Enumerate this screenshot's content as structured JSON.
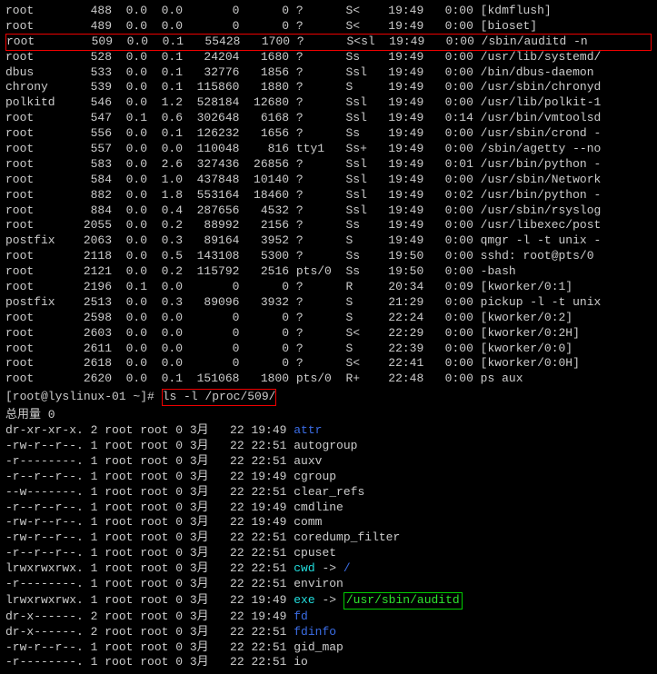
{
  "ps": [
    {
      "user": "root",
      "pid": "488",
      "c1": "0.0",
      "c2": "0.0",
      "vsz": "0",
      "rss": "0",
      "tty": "?",
      "stat": "S<",
      "start": "19:49",
      "time": "0:00",
      "cmd": "[kdmflush]",
      "boxed": false
    },
    {
      "user": "root",
      "pid": "489",
      "c1": "0.0",
      "c2": "0.0",
      "vsz": "0",
      "rss": "0",
      "tty": "?",
      "stat": "S<",
      "start": "19:49",
      "time": "0:00",
      "cmd": "[bioset]",
      "boxed": false
    },
    {
      "user": "root",
      "pid": "509",
      "c1": "0.0",
      "c2": "0.1",
      "vsz": "55428",
      "rss": "1700",
      "tty": "?",
      "stat": "S<sl",
      "start": "19:49",
      "time": "0:00",
      "cmd": "/sbin/auditd -n",
      "boxed": true
    },
    {
      "user": "root",
      "pid": "528",
      "c1": "0.0",
      "c2": "0.1",
      "vsz": "24204",
      "rss": "1680",
      "tty": "?",
      "stat": "Ss",
      "start": "19:49",
      "time": "0:00",
      "cmd": "/usr/lib/systemd/",
      "boxed": false
    },
    {
      "user": "dbus",
      "pid": "533",
      "c1": "0.0",
      "c2": "0.1",
      "vsz": "32776",
      "rss": "1856",
      "tty": "?",
      "stat": "Ssl",
      "start": "19:49",
      "time": "0:00",
      "cmd": "/bin/dbus-daemon",
      "boxed": false
    },
    {
      "user": "chrony",
      "pid": "539",
      "c1": "0.0",
      "c2": "0.1",
      "vsz": "115860",
      "rss": "1880",
      "tty": "?",
      "stat": "S",
      "start": "19:49",
      "time": "0:00",
      "cmd": "/usr/sbin/chronyd",
      "boxed": false
    },
    {
      "user": "polkitd",
      "pid": "546",
      "c1": "0.0",
      "c2": "1.2",
      "vsz": "528184",
      "rss": "12680",
      "tty": "?",
      "stat": "Ssl",
      "start": "19:49",
      "time": "0:00",
      "cmd": "/usr/lib/polkit-1",
      "boxed": false
    },
    {
      "user": "root",
      "pid": "547",
      "c1": "0.1",
      "c2": "0.6",
      "vsz": "302648",
      "rss": "6168",
      "tty": "?",
      "stat": "Ssl",
      "start": "19:49",
      "time": "0:14",
      "cmd": "/usr/bin/vmtoolsd",
      "boxed": false
    },
    {
      "user": "root",
      "pid": "556",
      "c1": "0.0",
      "c2": "0.1",
      "vsz": "126232",
      "rss": "1656",
      "tty": "?",
      "stat": "Ss",
      "start": "19:49",
      "time": "0:00",
      "cmd": "/usr/sbin/crond -",
      "boxed": false
    },
    {
      "user": "root",
      "pid": "557",
      "c1": "0.0",
      "c2": "0.0",
      "vsz": "110048",
      "rss": "816",
      "tty": "tty1",
      "stat": "Ss+",
      "start": "19:49",
      "time": "0:00",
      "cmd": "/sbin/agetty --no",
      "boxed": false
    },
    {
      "user": "root",
      "pid": "583",
      "c1": "0.0",
      "c2": "2.6",
      "vsz": "327436",
      "rss": "26856",
      "tty": "?",
      "stat": "Ssl",
      "start": "19:49",
      "time": "0:01",
      "cmd": "/usr/bin/python -",
      "boxed": false
    },
    {
      "user": "root",
      "pid": "584",
      "c1": "0.0",
      "c2": "1.0",
      "vsz": "437848",
      "rss": "10140",
      "tty": "?",
      "stat": "Ssl",
      "start": "19:49",
      "time": "0:00",
      "cmd": "/usr/sbin/Network",
      "boxed": false
    },
    {
      "user": "root",
      "pid": "882",
      "c1": "0.0",
      "c2": "1.8",
      "vsz": "553164",
      "rss": "18460",
      "tty": "?",
      "stat": "Ssl",
      "start": "19:49",
      "time": "0:02",
      "cmd": "/usr/bin/python -",
      "boxed": false
    },
    {
      "user": "root",
      "pid": "884",
      "c1": "0.0",
      "c2": "0.4",
      "vsz": "287656",
      "rss": "4532",
      "tty": "?",
      "stat": "Ssl",
      "start": "19:49",
      "time": "0:00",
      "cmd": "/usr/sbin/rsyslog",
      "boxed": false
    },
    {
      "user": "root",
      "pid": "2055",
      "c1": "0.0",
      "c2": "0.2",
      "vsz": "88992",
      "rss": "2156",
      "tty": "?",
      "stat": "Ss",
      "start": "19:49",
      "time": "0:00",
      "cmd": "/usr/libexec/post",
      "boxed": false
    },
    {
      "user": "postfix",
      "pid": "2063",
      "c1": "0.0",
      "c2": "0.3",
      "vsz": "89164",
      "rss": "3952",
      "tty": "?",
      "stat": "S",
      "start": "19:49",
      "time": "0:00",
      "cmd": "qmgr -l -t unix -",
      "boxed": false
    },
    {
      "user": "root",
      "pid": "2118",
      "c1": "0.0",
      "c2": "0.5",
      "vsz": "143108",
      "rss": "5300",
      "tty": "?",
      "stat": "Ss",
      "start": "19:50",
      "time": "0:00",
      "cmd": "sshd: root@pts/0",
      "boxed": false
    },
    {
      "user": "root",
      "pid": "2121",
      "c1": "0.0",
      "c2": "0.2",
      "vsz": "115792",
      "rss": "2516",
      "tty": "pts/0",
      "stat": "Ss",
      "start": "19:50",
      "time": "0:00",
      "cmd": "-bash",
      "boxed": false
    },
    {
      "user": "root",
      "pid": "2196",
      "c1": "0.1",
      "c2": "0.0",
      "vsz": "0",
      "rss": "0",
      "tty": "?",
      "stat": "R",
      "start": "20:34",
      "time": "0:09",
      "cmd": "[kworker/0:1]",
      "boxed": false
    },
    {
      "user": "postfix",
      "pid": "2513",
      "c1": "0.0",
      "c2": "0.3",
      "vsz": "89096",
      "rss": "3932",
      "tty": "?",
      "stat": "S",
      "start": "21:29",
      "time": "0:00",
      "cmd": "pickup -l -t unix",
      "boxed": false
    },
    {
      "user": "root",
      "pid": "2598",
      "c1": "0.0",
      "c2": "0.0",
      "vsz": "0",
      "rss": "0",
      "tty": "?",
      "stat": "S",
      "start": "22:24",
      "time": "0:00",
      "cmd": "[kworker/0:2]",
      "boxed": false
    },
    {
      "user": "root",
      "pid": "2603",
      "c1": "0.0",
      "c2": "0.0",
      "vsz": "0",
      "rss": "0",
      "tty": "?",
      "stat": "S<",
      "start": "22:29",
      "time": "0:00",
      "cmd": "[kworker/0:2H]",
      "boxed": false
    },
    {
      "user": "root",
      "pid": "2611",
      "c1": "0.0",
      "c2": "0.0",
      "vsz": "0",
      "rss": "0",
      "tty": "?",
      "stat": "S",
      "start": "22:39",
      "time": "0:00",
      "cmd": "[kworker/0:0]",
      "boxed": false
    },
    {
      "user": "root",
      "pid": "2618",
      "c1": "0.0",
      "c2": "0.0",
      "vsz": "0",
      "rss": "0",
      "tty": "?",
      "stat": "S<",
      "start": "22:41",
      "time": "0:00",
      "cmd": "[kworker/0:0H]",
      "boxed": false
    },
    {
      "user": "root",
      "pid": "2620",
      "c1": "0.0",
      "c2": "0.1",
      "vsz": "151068",
      "rss": "1800",
      "tty": "pts/0",
      "stat": "R+",
      "start": "22:48",
      "time": "0:00",
      "cmd": "ps aux",
      "boxed": false
    }
  ],
  "prompt": {
    "text": "[root@lyslinux-01 ~]# ",
    "cmd_plain": "ls -l /proc/509/"
  },
  "total_label": "总用量 0",
  "ls": [
    {
      "perm": "dr-xr-xr-x.",
      "n": "2",
      "o": "root",
      "g": "root",
      "s": "0",
      "m": "3月",
      "d": "22",
      "t": "19:49",
      "name": "attr",
      "cls": "blue"
    },
    {
      "perm": "-rw-r--r--.",
      "n": "1",
      "o": "root",
      "g": "root",
      "s": "0",
      "m": "3月",
      "d": "22",
      "t": "22:51",
      "name": "autogroup",
      "cls": ""
    },
    {
      "perm": "-r--------.",
      "n": "1",
      "o": "root",
      "g": "root",
      "s": "0",
      "m": "3月",
      "d": "22",
      "t": "22:51",
      "name": "auxv",
      "cls": ""
    },
    {
      "perm": "-r--r--r--.",
      "n": "1",
      "o": "root",
      "g": "root",
      "s": "0",
      "m": "3月",
      "d": "22",
      "t": "19:49",
      "name": "cgroup",
      "cls": ""
    },
    {
      "perm": "--w-------.",
      "n": "1",
      "o": "root",
      "g": "root",
      "s": "0",
      "m": "3月",
      "d": "22",
      "t": "22:51",
      "name": "clear_refs",
      "cls": ""
    },
    {
      "perm": "-r--r--r--.",
      "n": "1",
      "o": "root",
      "g": "root",
      "s": "0",
      "m": "3月",
      "d": "22",
      "t": "19:49",
      "name": "cmdline",
      "cls": ""
    },
    {
      "perm": "-rw-r--r--.",
      "n": "1",
      "o": "root",
      "g": "root",
      "s": "0",
      "m": "3月",
      "d": "22",
      "t": "19:49",
      "name": "comm",
      "cls": ""
    },
    {
      "perm": "-rw-r--r--.",
      "n": "1",
      "o": "root",
      "g": "root",
      "s": "0",
      "m": "3月",
      "d": "22",
      "t": "22:51",
      "name": "coredump_filter",
      "cls": ""
    },
    {
      "perm": "-r--r--r--.",
      "n": "1",
      "o": "root",
      "g": "root",
      "s": "0",
      "m": "3月",
      "d": "22",
      "t": "22:51",
      "name": "cpuset",
      "cls": ""
    },
    {
      "perm": "lrwxrwxrwx.",
      "n": "1",
      "o": "root",
      "g": "root",
      "s": "0",
      "m": "3月",
      "d": "22",
      "t": "22:51",
      "name": "cwd",
      "cls": "cyan",
      "arrow": " -> ",
      "target": "/",
      "tcls": "blue"
    },
    {
      "perm": "-r--------.",
      "n": "1",
      "o": "root",
      "g": "root",
      "s": "0",
      "m": "3月",
      "d": "22",
      "t": "22:51",
      "name": "environ",
      "cls": ""
    },
    {
      "perm": "lrwxrwxrwx.",
      "n": "1",
      "o": "root",
      "g": "root",
      "s": "0",
      "m": "3月",
      "d": "22",
      "t": "19:49",
      "name": "exe",
      "cls": "cyan",
      "arrow": " -> ",
      "target": "/usr/sbin/auditd",
      "tcls": "green",
      "tboxed": true
    },
    {
      "perm": "dr-x------.",
      "n": "2",
      "o": "root",
      "g": "root",
      "s": "0",
      "m": "3月",
      "d": "22",
      "t": "19:49",
      "name": "fd",
      "cls": "blue"
    },
    {
      "perm": "dr-x------.",
      "n": "2",
      "o": "root",
      "g": "root",
      "s": "0",
      "m": "3月",
      "d": "22",
      "t": "22:51",
      "name": "fdinfo",
      "cls": "blue"
    },
    {
      "perm": "-rw-r--r--.",
      "n": "1",
      "o": "root",
      "g": "root",
      "s": "0",
      "m": "3月",
      "d": "22",
      "t": "22:51",
      "name": "gid_map",
      "cls": ""
    },
    {
      "perm": "-r--------.",
      "n": "1",
      "o": "root",
      "g": "root",
      "s": "0",
      "m": "3月",
      "d": "22",
      "t": "22:51",
      "name": "io",
      "cls": ""
    }
  ]
}
